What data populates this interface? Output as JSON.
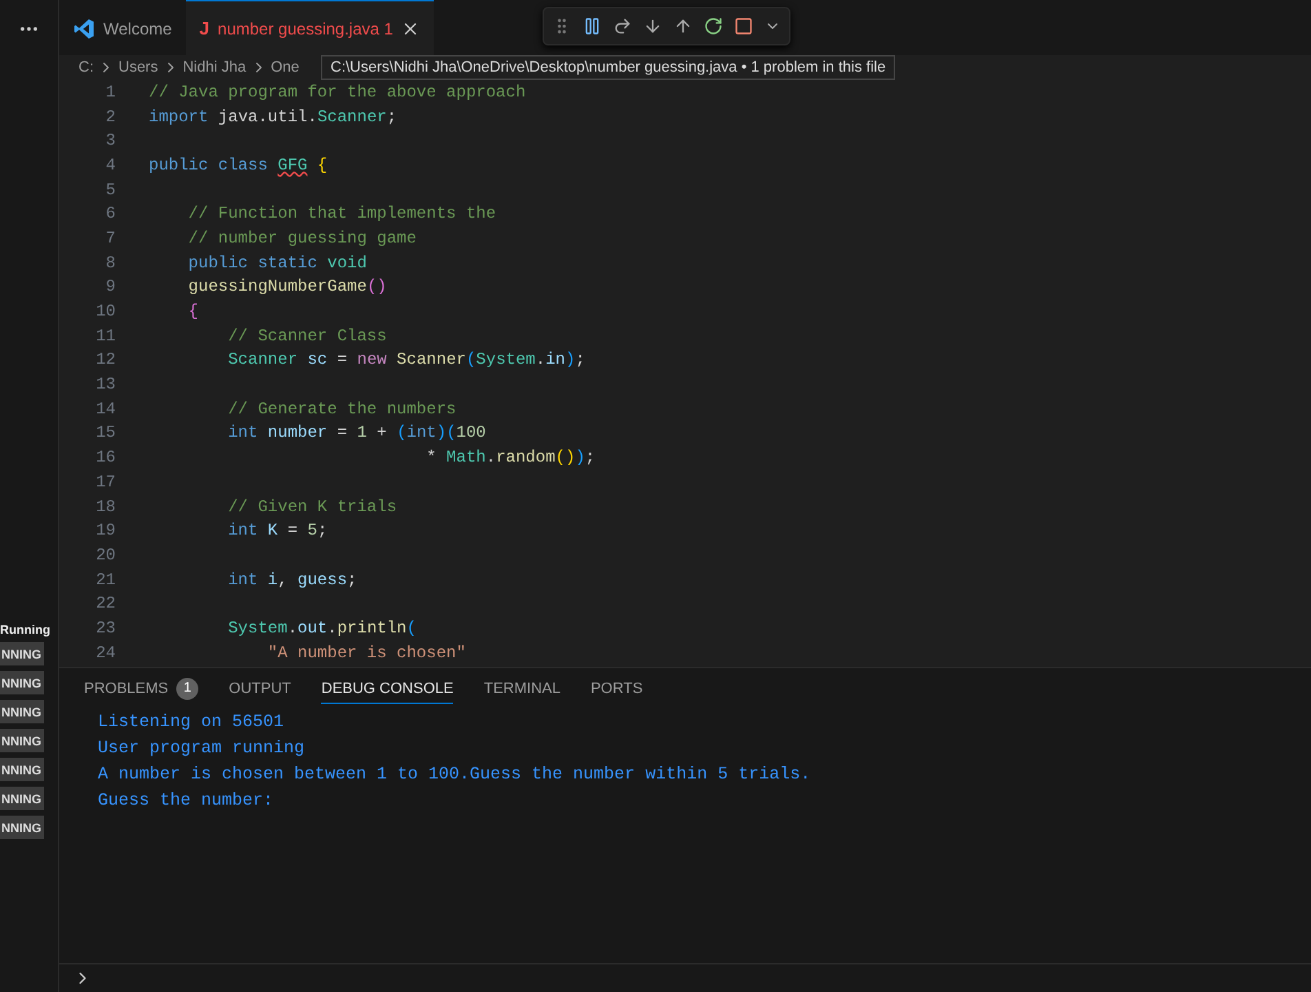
{
  "sidebar": {
    "section_label": "Running",
    "badges": [
      "NNING",
      "NNING",
      "NNING",
      "NNING",
      "NNING",
      "NNING",
      "NNING"
    ]
  },
  "tabs": [
    {
      "label": "Welcome",
      "kind": "welcome",
      "selected": false,
      "has_error": false
    },
    {
      "label": "number guessing.java",
      "kind": "file",
      "icon_letter": "J",
      "selected": true,
      "problems": "1",
      "has_error": true
    }
  ],
  "breadcrumb": [
    "C:",
    "Users",
    "Nidhi Jha",
    "One"
  ],
  "tooltip": "C:\\Users\\Nidhi Jha\\OneDrive\\Desktop\\number guessing.java • 1 problem in this file",
  "code_lines": [
    {
      "number": "1",
      "tokens": [
        {
          "kind": "comment",
          "text": "// Java program for the above approach"
        }
      ]
    },
    {
      "number": "2",
      "tokens": [
        {
          "kind": "keyword",
          "text": "import"
        },
        {
          "kind": "plain",
          "text": " java.util."
        },
        {
          "kind": "type",
          "text": "Scanner"
        },
        {
          "kind": "plain",
          "text": ";"
        }
      ]
    },
    {
      "number": "3"
    },
    {
      "number": "4",
      "tokens": [
        {
          "kind": "keyword",
          "text": "public class "
        },
        {
          "kind": "type-error",
          "text": "GFG"
        },
        {
          "kind": "bracket1",
          "text": " {"
        }
      ]
    },
    {
      "number": "5"
    },
    {
      "number": "6",
      "tokens": [
        {
          "kind": "comment",
          "text": "    // Function that implements the"
        }
      ]
    },
    {
      "number": "7",
      "tokens": [
        {
          "kind": "comment",
          "text": "    // number guessing game"
        }
      ]
    },
    {
      "number": "8",
      "tokens": [
        {
          "kind": "keyword",
          "text": "    public static "
        },
        {
          "kind": "type",
          "text": "void"
        }
      ]
    },
    {
      "number": "9",
      "tokens": [
        {
          "kind": "function",
          "text": "    guessingNumberGame"
        },
        {
          "kind": "bracket2",
          "text": "()"
        }
      ]
    },
    {
      "number": "10",
      "tokens": [
        {
          "kind": "bracket2",
          "text": "    {"
        }
      ]
    },
    {
      "number": "11",
      "tokens": [
        {
          "kind": "comment",
          "text": "        // Scanner Class"
        }
      ]
    },
    {
      "number": "12",
      "tokens": [
        {
          "kind": "type",
          "text": "        Scanner"
        },
        {
          "kind": "variable",
          "text": " sc"
        },
        {
          "kind": "plain",
          "text": " = "
        },
        {
          "kind": "control",
          "text": "new"
        },
        {
          "kind": "function",
          "text": " Scanner"
        },
        {
          "kind": "bracket3",
          "text": "("
        },
        {
          "kind": "type",
          "text": "System"
        },
        {
          "kind": "plain",
          "text": "."
        },
        {
          "kind": "variable",
          "text": "in"
        },
        {
          "kind": "bracket3",
          "text": ")"
        },
        {
          "kind": "plain",
          "text": ";"
        }
      ]
    },
    {
      "number": "13"
    },
    {
      "number": "14",
      "tokens": [
        {
          "kind": "comment",
          "text": "        // Generate the numbers"
        }
      ]
    },
    {
      "number": "15",
      "tokens": [
        {
          "kind": "keyword",
          "text": "        int"
        },
        {
          "kind": "variable",
          "text": " number"
        },
        {
          "kind": "plain",
          "text": " = "
        },
        {
          "kind": "number",
          "text": "1"
        },
        {
          "kind": "plain",
          "text": " + "
        },
        {
          "kind": "bracket3",
          "text": "("
        },
        {
          "kind": "keyword",
          "text": "int"
        },
        {
          "kind": "bracket3",
          "text": ")("
        },
        {
          "kind": "number",
          "text": "100"
        }
      ]
    },
    {
      "number": "16",
      "tokens": [
        {
          "kind": "plain",
          "text": "                            * "
        },
        {
          "kind": "type",
          "text": "Math"
        },
        {
          "kind": "plain",
          "text": "."
        },
        {
          "kind": "function",
          "text": "random"
        },
        {
          "kind": "bracket1",
          "text": "()"
        },
        {
          "kind": "bracket3",
          "text": ")"
        },
        {
          "kind": "plain",
          "text": ";"
        }
      ]
    },
    {
      "number": "17"
    },
    {
      "number": "18",
      "tokens": [
        {
          "kind": "comment",
          "text": "        // Given K trials"
        }
      ]
    },
    {
      "number": "19",
      "tokens": [
        {
          "kind": "keyword",
          "text": "        int"
        },
        {
          "kind": "variable",
          "text": " K"
        },
        {
          "kind": "plain",
          "text": " = "
        },
        {
          "kind": "number",
          "text": "5"
        },
        {
          "kind": "plain",
          "text": ";"
        }
      ]
    },
    {
      "number": "20"
    },
    {
      "number": "21",
      "tokens": [
        {
          "kind": "keyword",
          "text": "        int"
        },
        {
          "kind": "variable",
          "text": " i"
        },
        {
          "kind": "plain",
          "text": ", "
        },
        {
          "kind": "variable",
          "text": "guess"
        },
        {
          "kind": "plain",
          "text": ";"
        }
      ]
    },
    {
      "number": "22"
    },
    {
      "number": "23",
      "tokens": [
        {
          "kind": "type",
          "text": "        System"
        },
        {
          "kind": "plain",
          "text": "."
        },
        {
          "kind": "variable",
          "text": "out"
        },
        {
          "kind": "plain",
          "text": "."
        },
        {
          "kind": "function",
          "text": "println"
        },
        {
          "kind": "bracket3",
          "text": "("
        }
      ]
    },
    {
      "number": "24",
      "tokens": [
        {
          "kind": "string",
          "text": "            \"A number is chosen\""
        }
      ]
    }
  ],
  "panel_tabs": [
    {
      "label": "PROBLEMS",
      "badge": "1",
      "selected": false
    },
    {
      "label": "OUTPUT",
      "selected": false
    },
    {
      "label": "DEBUG CONSOLE",
      "selected": true
    },
    {
      "label": "TERMINAL",
      "selected": false
    },
    {
      "label": "PORTS",
      "selected": false
    }
  ],
  "console_lines": [
    "Listening on 56501",
    "User program running",
    "A number is chosen between 1 to 100.Guess the number within 5 trials.",
    "Guess the number:"
  ]
}
